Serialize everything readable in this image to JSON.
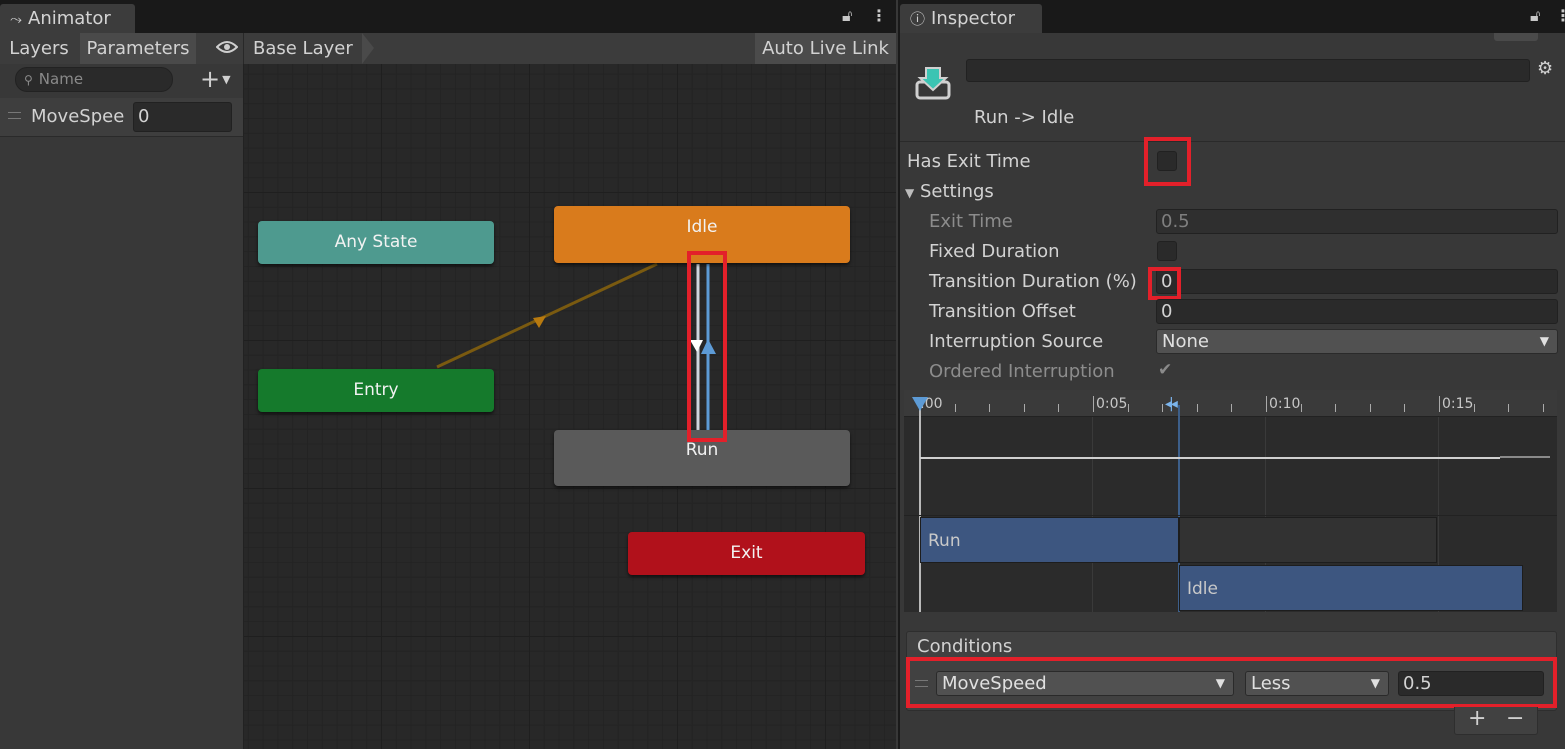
{
  "animator": {
    "tab_title": "Animator",
    "left_tabs": [
      "Layers",
      "Parameters"
    ],
    "search_placeholder": "Name",
    "add_label": "+",
    "parameter": {
      "name": "MoveSpee",
      "value": "0"
    },
    "breadcrumb": "Base Layer",
    "auto_live_link": "Auto Live Link",
    "states": {
      "any_state": "Any State",
      "entry": "Entry",
      "idle": "Idle",
      "run": "Run",
      "exit": "Exit"
    },
    "colors": {
      "any_state": "#4e9a8f",
      "entry": "#157a2c",
      "idle": "#d97b1c",
      "run": "#5a5a5a",
      "exit": "#b1111b",
      "transition": "#5d9bd6",
      "highlight": "#e3202a"
    }
  },
  "inspector": {
    "tab_title": "Inspector",
    "transition_name": "Run -> Idle",
    "has_exit_time_label": "Has Exit Time",
    "settings_label": "Settings",
    "exit_time_label": "Exit Time",
    "exit_time_value": "0.5",
    "fixed_duration_label": "Fixed Duration",
    "transition_duration_label": "Transition Duration (%)",
    "transition_duration_value": "0",
    "transition_offset_label": "Transition Offset",
    "transition_offset_value": "0",
    "interruption_source_label": "Interruption Source",
    "interruption_source_value": "None",
    "ordered_interruption_label": "Ordered Interruption",
    "timeline": {
      "ticks": [
        ":00",
        "0:05",
        "0:10",
        "0:15"
      ],
      "from_state": "Run",
      "to_state": "Idle"
    },
    "conditions_label": "Conditions",
    "condition": {
      "parameter": "MoveSpeed",
      "mode": "Less",
      "threshold": "0.5"
    },
    "add_label": "+",
    "remove_label": "−"
  }
}
